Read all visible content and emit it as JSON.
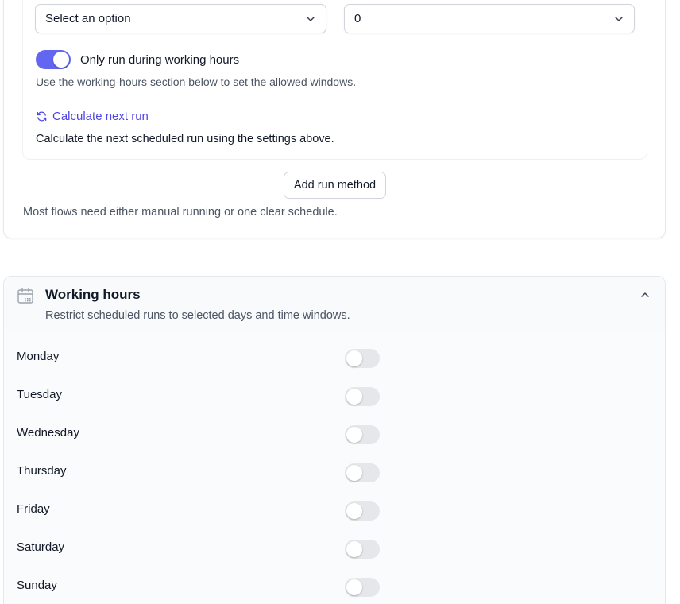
{
  "schedule": {
    "select_primary": {
      "value": "Select an option"
    },
    "select_secondary": {
      "value": "0"
    },
    "working_hours_toggle": {
      "label": "Only run during working hours",
      "on": true
    },
    "help_text": "Use the working-hours section below to set the allowed windows.",
    "calculate_link": "Calculate next run",
    "calculate_desc": "Calculate the next scheduled run using the settings above.",
    "add_button": "Add run method",
    "note": "Most flows need either manual running or one clear schedule."
  },
  "working_hours": {
    "title": "Working hours",
    "subtitle": "Restrict scheduled runs to selected days and time windows.",
    "days": [
      {
        "label": "Monday",
        "enabled": false
      },
      {
        "label": "Tuesday",
        "enabled": false
      },
      {
        "label": "Wednesday",
        "enabled": false
      },
      {
        "label": "Thursday",
        "enabled": false
      },
      {
        "label": "Friday",
        "enabled": false
      },
      {
        "label": "Saturday",
        "enabled": false
      },
      {
        "label": "Sunday",
        "enabled": false
      }
    ]
  },
  "colors": {
    "accent": "#6366f1",
    "link": "#4f46e5",
    "switch_off": "#e5e7eb"
  },
  "icons": {
    "select_chevron": "chevron-down-icon",
    "calculate": "refresh-icon",
    "section": "calendar-icon",
    "collapse": "chevron-up-icon"
  }
}
